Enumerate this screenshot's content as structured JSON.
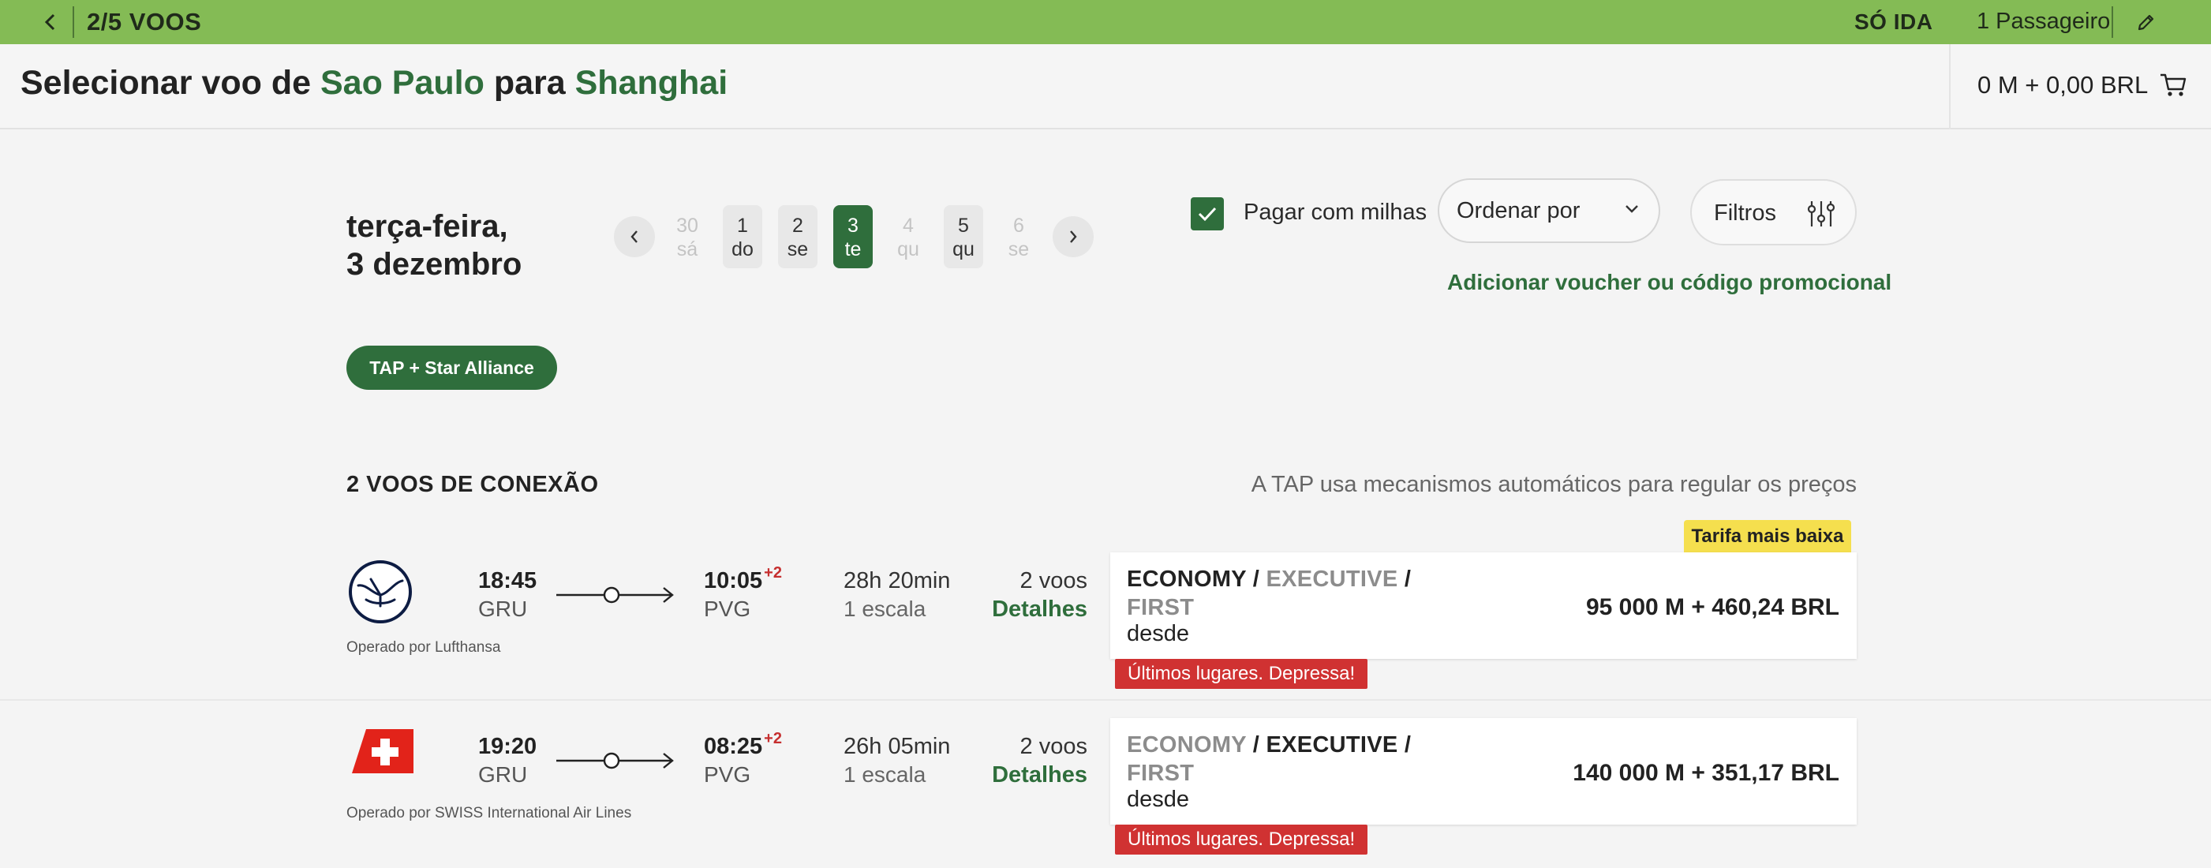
{
  "topbar": {
    "step": "2/5 VOOS",
    "trip_type": "SÓ IDA",
    "passengers": "1 Passageiro"
  },
  "header": {
    "title_prefix": "Selecionar voo de",
    "origin": "Sao Paulo",
    "title_mid": "para",
    "destination": "Shanghai",
    "cart_total": "0 M + 0,00 BRL"
  },
  "date": {
    "weekday": "terça-feira,",
    "date": "3 dezembro",
    "days": [
      {
        "num": "30",
        "wd": "sá",
        "state": "disabled"
      },
      {
        "num": "1",
        "wd": "do",
        "state": "available"
      },
      {
        "num": "2",
        "wd": "se",
        "state": "available"
      },
      {
        "num": "3",
        "wd": "te",
        "state": "selected"
      },
      {
        "num": "4",
        "wd": "qu",
        "state": "disabled"
      },
      {
        "num": "5",
        "wd": "qu",
        "state": "available"
      },
      {
        "num": "6",
        "wd": "se",
        "state": "disabled"
      }
    ]
  },
  "controls": {
    "pay_miles_label": "Pagar com milhas",
    "pay_miles_checked": true,
    "sort_label": "Ordenar por",
    "filters_label": "Filtros",
    "voucher_link": "Adicionar voucher ou código promocional"
  },
  "alliance_chip": "TAP + Star Alliance",
  "results": {
    "title": "2 VOOS DE CONEXÃO",
    "note": "A TAP usa mecanismos automáticos para regular os preços",
    "lowest_badge": "Tarifa mais baixa",
    "flights": [
      {
        "airline_icon": "lufthansa-logo",
        "operated_by": "Operado por Lufthansa",
        "dep_time": "18:45",
        "dep_code": "GRU",
        "arr_time": "10:05",
        "arr_offset": "+2",
        "arr_code": "PVG",
        "duration": "28h 20min",
        "stops": "1 escala",
        "segments": "2 voos",
        "details": "Detalhes",
        "class_a": "ECONOMY",
        "class_b": "EXECUTIVE",
        "class_c": "FIRST",
        "highlight": "economy",
        "from": "desde",
        "price": "95 000 M + 460,24 BRL",
        "warning": "Últimos lugares. Depressa!"
      },
      {
        "airline_icon": "swiss-logo",
        "operated_by": "Operado por SWISS International Air Lines",
        "dep_time": "19:20",
        "dep_code": "GRU",
        "arr_time": "08:25",
        "arr_offset": "+2",
        "arr_code": "PVG",
        "duration": "26h 05min",
        "stops": "1 escala",
        "segments": "2 voos",
        "details": "Detalhes",
        "class_a": "ECONOMY",
        "class_b": "EXECUTIVE",
        "class_c": "FIRST",
        "highlight": "executive",
        "from": "desde",
        "price": "140 000 M + 351,17 BRL",
        "warning": "Últimos lugares. Depressa!"
      }
    ]
  },
  "colors": {
    "topbar": "#84bb55",
    "brand_green": "#2f6e3c",
    "warning_red": "#d03232",
    "badge_yellow": "#f5df4e"
  }
}
